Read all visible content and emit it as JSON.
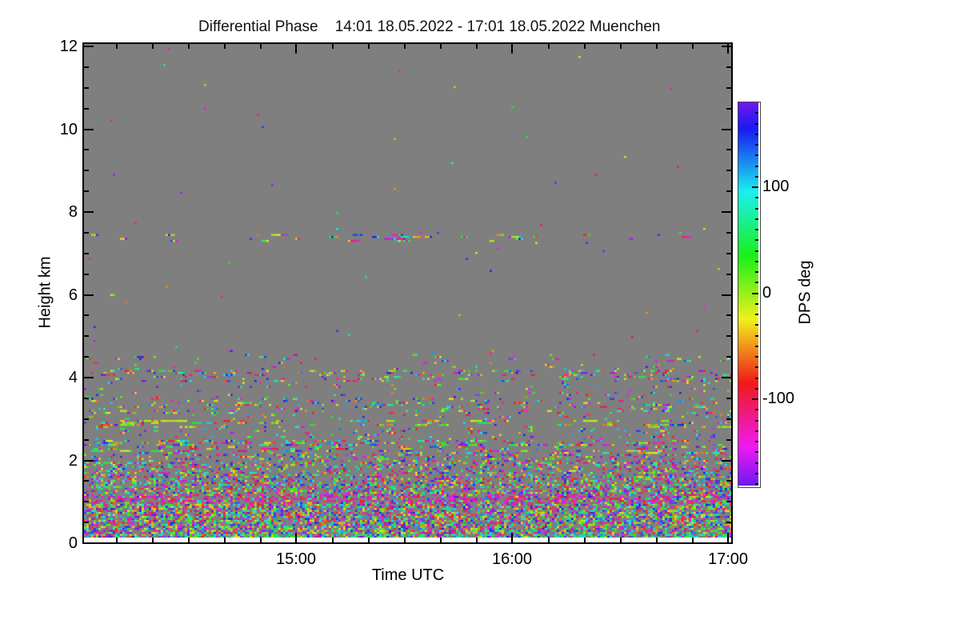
{
  "chart": {
    "title": "Differential Phase    14:01 18.05.2022 - 17:01 18.05.2022 Muenchen",
    "x_label": "Time UTC",
    "y_label": "Height km",
    "colorbar_label": "DPS deg"
  },
  "chart_data": {
    "type": "heatmap",
    "title": "Differential Phase    14:01 18.05.2022 - 17:01 18.05.2022 Muenchen",
    "xlabel": "Time UTC",
    "ylabel": "Height km",
    "x_range_utc": [
      "14:01",
      "17:01"
    ],
    "x_ticks": [
      "15:00",
      "16:00",
      "17:00"
    ],
    "x_minor_tick_minutes": 10,
    "y_range_km": [
      0,
      12
    ],
    "y_ticks": [
      0,
      2,
      4,
      6,
      8,
      10,
      12
    ],
    "y_minor_step_km": 0.5,
    "grid": false,
    "no_data_color": "#7f7f7f",
    "colorbar": {
      "label": "DPS deg",
      "tick_labels": [
        "100",
        "0",
        "-100"
      ],
      "tick_values": [
        100,
        0,
        -100
      ],
      "minor_tick_step_deg": 10,
      "value_range_deg": [
        -180,
        180
      ],
      "colormap": "cyclic-hue (violet @ +180 > blue > cyan > green @ ~+40 > yellow-green @ 0 > orange > red @ ~-100 > magenta > violet @ -180)",
      "hue_at_zero_deg": 85
    },
    "content_description": "Random differential-phase speckle over gray no-data background; dense multicolor noise below ~1.5 km, magenta-dominated band near 1 km, sparse speckle bands near 2.3, 2.9, 3.3, 4.0 km, thin speckled line near 7.35 km, near-empty above.",
    "speckle_layers": [
      {
        "h_min": 7.45,
        "h_max": 12.0,
        "density": 0.0012,
        "max_run": 1
      },
      {
        "h_min": 7.28,
        "h_max": 7.45,
        "density": 0.09,
        "max_run": 5
      },
      {
        "h_min": 6.1,
        "h_max": 7.28,
        "density": 0.0015,
        "max_run": 1
      },
      {
        "h_min": 5.95,
        "h_max": 6.1,
        "density": 0.005,
        "max_run": 2
      },
      {
        "h_min": 4.7,
        "h_max": 5.95,
        "density": 0.0018,
        "max_run": 1
      },
      {
        "h_min": 4.52,
        "h_max": 4.7,
        "density": 0.012,
        "max_run": 2
      },
      {
        "h_min": 4.38,
        "h_max": 4.52,
        "density": 0.05,
        "max_run": 3
      },
      {
        "h_min": 4.15,
        "h_max": 4.38,
        "density": 0.035,
        "max_run": 2
      },
      {
        "h_min": 3.88,
        "h_max": 4.15,
        "density": 0.2,
        "max_run": 3
      },
      {
        "h_min": 3.5,
        "h_max": 3.88,
        "density": 0.05,
        "max_run": 2
      },
      {
        "h_min": 3.12,
        "h_max": 3.5,
        "density": 0.2,
        "max_run": 3
      },
      {
        "h_min": 2.98,
        "h_max": 3.12,
        "density": 0.07,
        "max_run": 2
      },
      {
        "h_min": 2.78,
        "h_max": 2.98,
        "density": 0.28,
        "max_run": 6,
        "color_bias": "warm"
      },
      {
        "h_min": 2.45,
        "h_max": 2.78,
        "density": 0.1,
        "max_run": 2
      },
      {
        "h_min": 2.15,
        "h_max": 2.45,
        "density": 0.33,
        "max_run": 5
      },
      {
        "h_min": 1.95,
        "h_max": 2.15,
        "density": 0.3,
        "max_run": 2
      },
      {
        "h_min": 1.65,
        "h_max": 1.95,
        "density": 0.42,
        "max_run": 2
      },
      {
        "h_min": 1.4,
        "h_max": 1.65,
        "density": 0.55,
        "max_run": 2
      },
      {
        "h_min": 1.18,
        "h_max": 1.4,
        "density": 0.72,
        "max_run": 2
      },
      {
        "h_min": 0.95,
        "h_max": 1.18,
        "density": 0.93,
        "max_run": 3,
        "color_bias": "magenta"
      },
      {
        "h_min": 0.18,
        "h_max": 0.95,
        "density": 0.9,
        "max_run": 2
      },
      {
        "h_min": 0.0,
        "h_max": 0.18,
        "density": 0.95,
        "max_run": 2,
        "color_bias": "green"
      }
    ]
  }
}
